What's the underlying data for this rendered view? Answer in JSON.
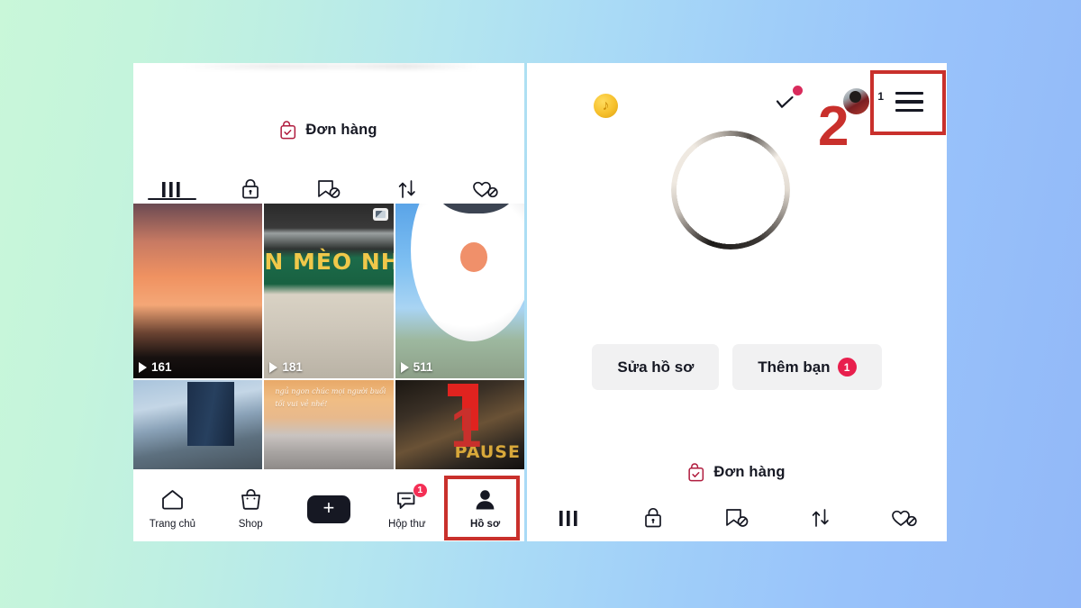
{
  "background": {
    "from": "#c9f7d9",
    "to": "#92b8f8"
  },
  "annotations": {
    "step1_label": "1",
    "step2_label": "2",
    "box_color": "#c9302c"
  },
  "left_panel": {
    "order_row": {
      "label": "Đơn hàng",
      "icon": "shopping-bag-check-icon",
      "color": "#b01c3e"
    },
    "tabs": [
      {
        "name": "videos-tab",
        "icon": "grid-icon",
        "active": true
      },
      {
        "name": "private-tab",
        "icon": "lock-icon",
        "active": false
      },
      {
        "name": "saved-tab",
        "icon": "bookmark-hidden-icon",
        "active": false
      },
      {
        "name": "reposts-tab",
        "icon": "repost-arrows-icon",
        "active": false
      },
      {
        "name": "liked-tab",
        "icon": "heart-hidden-icon",
        "active": false
      }
    ],
    "videos": [
      {
        "views": "161",
        "alt": "sunset-sky",
        "multi": false
      },
      {
        "views": "181",
        "alt": "meo-nho-storefront",
        "sign": "N MÈO NHỎ",
        "multi": true
      },
      {
        "views": "511",
        "alt": "white-inflatable-figure",
        "multi": false
      },
      {
        "views": "",
        "alt": "city-building",
        "multi": false
      },
      {
        "views": "",
        "alt": "sunset-handwriting",
        "handwriting": "ngủ ngon\nchúc mọi người\nbuổi tối vui vẻ nhé!",
        "multi": false
      },
      {
        "views": "",
        "alt": "pause-cafe",
        "sign": "PAUSE",
        "multi": false
      }
    ],
    "bottom_nav": [
      {
        "name": "nav-home",
        "label": "Trang chủ",
        "icon": "home-icon",
        "badge": "",
        "highlighted": false
      },
      {
        "name": "nav-shop",
        "label": "Shop",
        "icon": "shop-bag-icon",
        "badge": "",
        "highlighted": false
      },
      {
        "name": "nav-create",
        "label": "",
        "icon": "plus-icon",
        "badge": "",
        "highlighted": false
      },
      {
        "name": "nav-inbox",
        "label": "Hộp thư",
        "icon": "inbox-icon",
        "badge": "1",
        "highlighted": false
      },
      {
        "name": "nav-profile",
        "label": "Hồ sơ",
        "icon": "person-icon",
        "badge": "",
        "highlighted": true
      }
    ]
  },
  "right_panel": {
    "coin_icon": "tiktok-coin-icon",
    "check_icon": "check-icon",
    "notification_dot_color": "#d92b5c",
    "avatar_count": "1",
    "menu_icon": "hamburger-menu-icon",
    "actions": [
      {
        "name": "edit-profile-button",
        "label": "Sửa hồ sơ",
        "badge": ""
      },
      {
        "name": "add-friends-button",
        "label": "Thêm bạn",
        "badge": "1"
      }
    ],
    "order_row": {
      "label": "Đơn hàng",
      "icon": "shopping-bag-check-icon",
      "color": "#b01c3e"
    },
    "tabs": [
      {
        "name": "videos-tab",
        "icon": "grid-icon",
        "active": false
      },
      {
        "name": "private-tab",
        "icon": "lock-icon",
        "active": false
      },
      {
        "name": "saved-tab",
        "icon": "bookmark-hidden-icon",
        "active": false
      },
      {
        "name": "reposts-tab",
        "icon": "repost-arrows-icon",
        "active": false
      },
      {
        "name": "liked-tab",
        "icon": "heart-hidden-icon",
        "active": false
      }
    ]
  }
}
